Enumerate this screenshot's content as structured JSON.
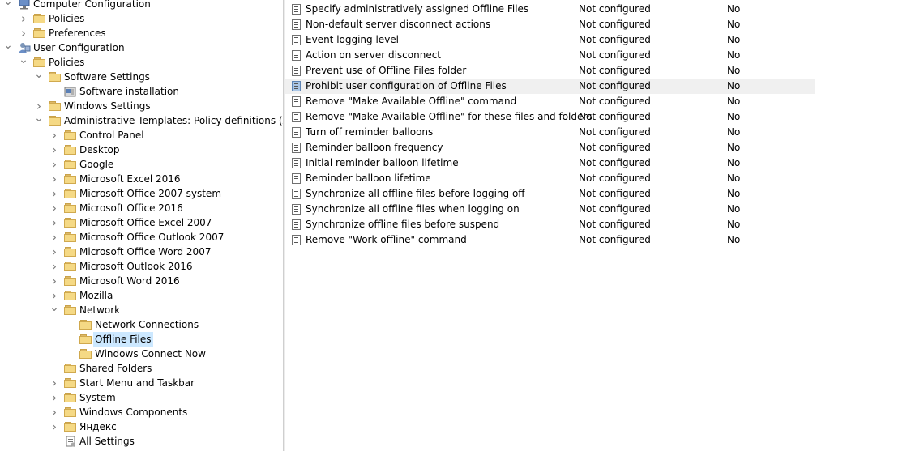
{
  "tree": [
    {
      "label": "Computer Configuration",
      "level": 0,
      "toggle": "expanded",
      "icon": "computer-icon"
    },
    {
      "label": "Policies",
      "level": 1,
      "toggle": "collapsed",
      "icon": "folder-icon"
    },
    {
      "label": "Preferences",
      "level": 1,
      "toggle": "collapsed",
      "icon": "folder-icon"
    },
    {
      "label": "User Configuration",
      "level": 0,
      "toggle": "expanded",
      "icon": "user-icon"
    },
    {
      "label": "Policies",
      "level": 1,
      "toggle": "expanded",
      "icon": "folder-icon"
    },
    {
      "label": "Software Settings",
      "level": 2,
      "toggle": "expanded",
      "icon": "folder-icon"
    },
    {
      "label": "Software installation",
      "level": 3,
      "toggle": "none",
      "icon": "software-installation-icon"
    },
    {
      "label": "Windows Settings",
      "level": 2,
      "toggle": "collapsed",
      "icon": "folder-icon"
    },
    {
      "label": "Administrative Templates: Policy definitions (ADMX files) retrieved from the local computer.",
      "level": 2,
      "toggle": "expanded",
      "icon": "folder-icon"
    },
    {
      "label": "Control Panel",
      "level": 3,
      "toggle": "collapsed",
      "icon": "folder-icon"
    },
    {
      "label": "Desktop",
      "level": 3,
      "toggle": "collapsed",
      "icon": "folder-icon"
    },
    {
      "label": "Google",
      "level": 3,
      "toggle": "collapsed",
      "icon": "folder-icon"
    },
    {
      "label": "Microsoft Excel 2016",
      "level": 3,
      "toggle": "collapsed",
      "icon": "folder-icon"
    },
    {
      "label": "Microsoft Office 2007 system",
      "level": 3,
      "toggle": "collapsed",
      "icon": "folder-icon"
    },
    {
      "label": "Microsoft Office 2016",
      "level": 3,
      "toggle": "collapsed",
      "icon": "folder-icon"
    },
    {
      "label": "Microsoft Office Excel 2007",
      "level": 3,
      "toggle": "collapsed",
      "icon": "folder-icon"
    },
    {
      "label": "Microsoft Office Outlook 2007",
      "level": 3,
      "toggle": "collapsed",
      "icon": "folder-icon"
    },
    {
      "label": "Microsoft Office Word 2007",
      "level": 3,
      "toggle": "collapsed",
      "icon": "folder-icon"
    },
    {
      "label": "Microsoft Outlook 2016",
      "level": 3,
      "toggle": "collapsed",
      "icon": "folder-icon"
    },
    {
      "label": "Microsoft Word 2016",
      "level": 3,
      "toggle": "collapsed",
      "icon": "folder-icon"
    },
    {
      "label": "Mozilla",
      "level": 3,
      "toggle": "collapsed",
      "icon": "folder-icon"
    },
    {
      "label": "Network",
      "level": 3,
      "toggle": "expanded",
      "icon": "folder-icon"
    },
    {
      "label": "Network Connections",
      "level": 4,
      "toggle": "none",
      "icon": "folder-icon"
    },
    {
      "label": "Offline Files",
      "level": 4,
      "toggle": "none",
      "icon": "folder-icon",
      "selected": true
    },
    {
      "label": "Windows Connect Now",
      "level": 4,
      "toggle": "none",
      "icon": "folder-icon"
    },
    {
      "label": "Shared Folders",
      "level": 3,
      "toggle": "none",
      "icon": "folder-icon"
    },
    {
      "label": "Start Menu and Taskbar",
      "level": 3,
      "toggle": "collapsed",
      "icon": "folder-icon"
    },
    {
      "label": "System",
      "level": 3,
      "toggle": "collapsed",
      "icon": "folder-icon"
    },
    {
      "label": "Windows Components",
      "level": 3,
      "toggle": "collapsed",
      "icon": "folder-icon"
    },
    {
      "label": "Яндекс",
      "level": 3,
      "toggle": "collapsed",
      "icon": "folder-icon"
    },
    {
      "label": "All Settings",
      "level": 3,
      "toggle": "none",
      "icon": "all-settings-icon"
    }
  ],
  "policies": [
    {
      "name": "Specify administratively assigned Offline Files",
      "state": "Not configured",
      "comment": "No"
    },
    {
      "name": "Non-default server disconnect actions",
      "state": "Not configured",
      "comment": "No"
    },
    {
      "name": "Event logging level",
      "state": "Not configured",
      "comment": "No"
    },
    {
      "name": "Action on server disconnect",
      "state": "Not configured",
      "comment": "No"
    },
    {
      "name": "Prevent use of Offline Files folder",
      "state": "Not configured",
      "comment": "No"
    },
    {
      "name": "Prohibit user configuration of Offline Files",
      "state": "Not configured",
      "comment": "No",
      "highlighted": true
    },
    {
      "name": "Remove \"Make Available Offline\" command",
      "state": "Not configured",
      "comment": "No"
    },
    {
      "name": "Remove \"Make Available Offline\" for these files and folders",
      "state": "Not configured",
      "comment": "No"
    },
    {
      "name": "Turn off reminder balloons",
      "state": "Not configured",
      "comment": "No"
    },
    {
      "name": "Reminder balloon frequency",
      "state": "Not configured",
      "comment": "No"
    },
    {
      "name": "Initial reminder balloon lifetime",
      "state": "Not configured",
      "comment": "No"
    },
    {
      "name": "Reminder balloon lifetime",
      "state": "Not configured",
      "comment": "No"
    },
    {
      "name": "Synchronize all offline files before logging off",
      "state": "Not configured",
      "comment": "No"
    },
    {
      "name": "Synchronize all offline files when logging on",
      "state": "Not configured",
      "comment": "No"
    },
    {
      "name": "Synchronize offline files before suspend",
      "state": "Not configured",
      "comment": "No"
    },
    {
      "name": "Remove \"Work offline\" command",
      "state": "Not configured",
      "comment": "No"
    }
  ]
}
